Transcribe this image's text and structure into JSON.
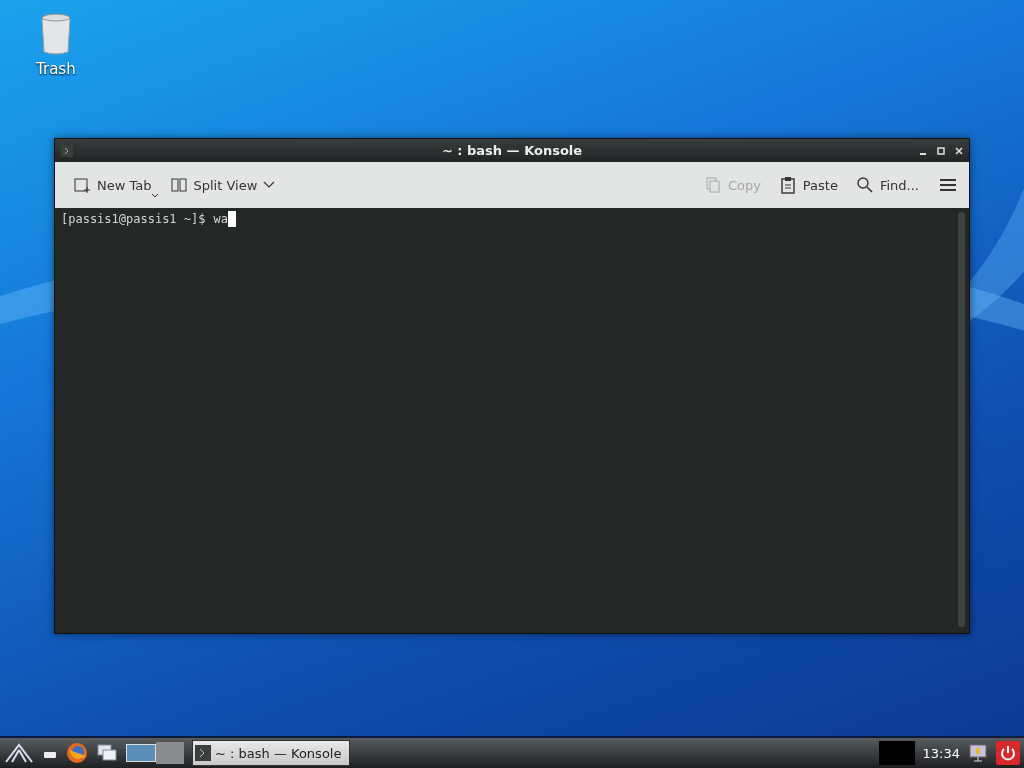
{
  "desktop": {
    "icons": [
      {
        "label": "Trash"
      }
    ]
  },
  "window": {
    "title": "~ : bash — Konsole",
    "toolbar": [
      {
        "kind": "new-tab",
        "label": "New Tab",
        "disabled": false
      },
      {
        "kind": "split",
        "label": "Split View",
        "disabled": false
      },
      {
        "kind": "copy",
        "label": "Copy",
        "disabled": true
      },
      {
        "kind": "paste",
        "label": "Paste",
        "disabled": false
      },
      {
        "kind": "find",
        "label": "Find...",
        "disabled": false
      }
    ],
    "terminal": {
      "prompt": "[passis1@passis1 ~]$",
      "input": "wa"
    }
  },
  "taskbar": {
    "tasks": [
      {
        "label": "~ : bash — Konsole",
        "selected": true
      }
    ],
    "clock": "13:34"
  }
}
